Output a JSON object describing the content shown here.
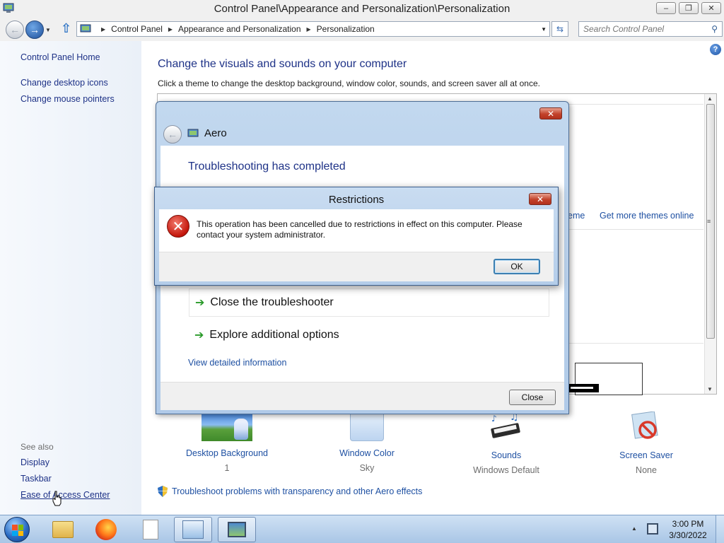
{
  "window": {
    "title": "Control Panel\\Appearance and Personalization\\Personalization",
    "minimize": "‒",
    "maximize": "❐",
    "close": "✕"
  },
  "address": {
    "crumbs": [
      "Control Panel",
      "Appearance and Personalization",
      "Personalization"
    ],
    "search_placeholder": "Search Control Panel"
  },
  "sidebar": {
    "home": "Control Panel Home",
    "links": [
      "Change desktop icons",
      "Change mouse pointers"
    ],
    "see_also_label": "See also",
    "see_also": [
      "Display",
      "Taskbar",
      "Ease of Access Center"
    ]
  },
  "main": {
    "heading": "Change the visuals and sounds on your computer",
    "subheading": "Click a theme to change the desktop background, window color, sounds, and screen saver all at once.",
    "theme_links": [
      "eme",
      "Get more themes online"
    ],
    "tiles": [
      {
        "label": "Desktop Background",
        "value": "1"
      },
      {
        "label": "Window Color",
        "value": "Sky"
      },
      {
        "label": "Sounds",
        "value": "Windows Default"
      },
      {
        "label": "Screen Saver",
        "value": "None"
      }
    ],
    "troubleshoot_link": "Troubleshoot problems with transparency and other Aero effects"
  },
  "troubleshooter": {
    "title": "Aero",
    "heading": "Troubleshooting has completed",
    "options": [
      "Close the troubleshooter",
      "Explore additional options"
    ],
    "detail_link": "View detailed information",
    "close_button": "Close"
  },
  "restrictions": {
    "title": "Restrictions",
    "message": "This operation has been cancelled due to restrictions in effect on this computer. Please contact your system administrator.",
    "ok_button": "OK"
  },
  "taskbar": {
    "time": "3:00 PM",
    "date": "3/30/2022"
  }
}
